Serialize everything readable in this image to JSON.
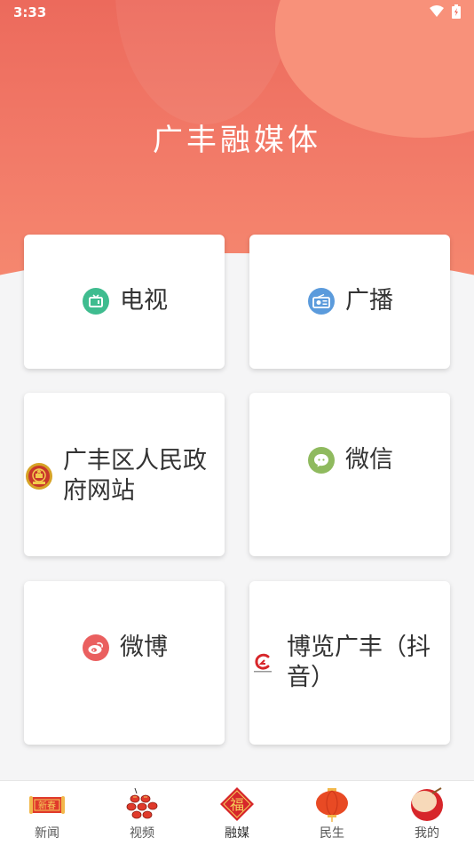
{
  "status": {
    "time": "3:33"
  },
  "header": {
    "title": "广丰融媒体"
  },
  "cards": [
    {
      "label": "电视",
      "icon": "tv-icon",
      "color": "#3fbc8f"
    },
    {
      "label": "广播",
      "icon": "radio-icon",
      "color": "#5b9bdc"
    },
    {
      "label": "广丰区人民政府网站",
      "icon": "national-emblem-icon",
      "color": "#c8382b"
    },
    {
      "label": "微信",
      "icon": "wechat-icon",
      "color": "#8fba5e"
    },
    {
      "label": "微博",
      "icon": "weibo-icon",
      "color": "#ea5f5f"
    },
    {
      "label": "博览广丰（抖音）",
      "icon": "guangfeng-logo-icon",
      "color": "#d7262a"
    }
  ],
  "tabs": [
    {
      "label": "新闻",
      "icon": "new-year-banner-icon"
    },
    {
      "label": "视频",
      "icon": "firecracker-icon"
    },
    {
      "label": "融媒",
      "icon": "fu-diamond-icon"
    },
    {
      "label": "民生",
      "icon": "lantern-icon"
    },
    {
      "label": "我的",
      "icon": "drum-icon"
    }
  ],
  "colors": {
    "accent": "#ec6a5c",
    "background": "#f5f5f6"
  }
}
